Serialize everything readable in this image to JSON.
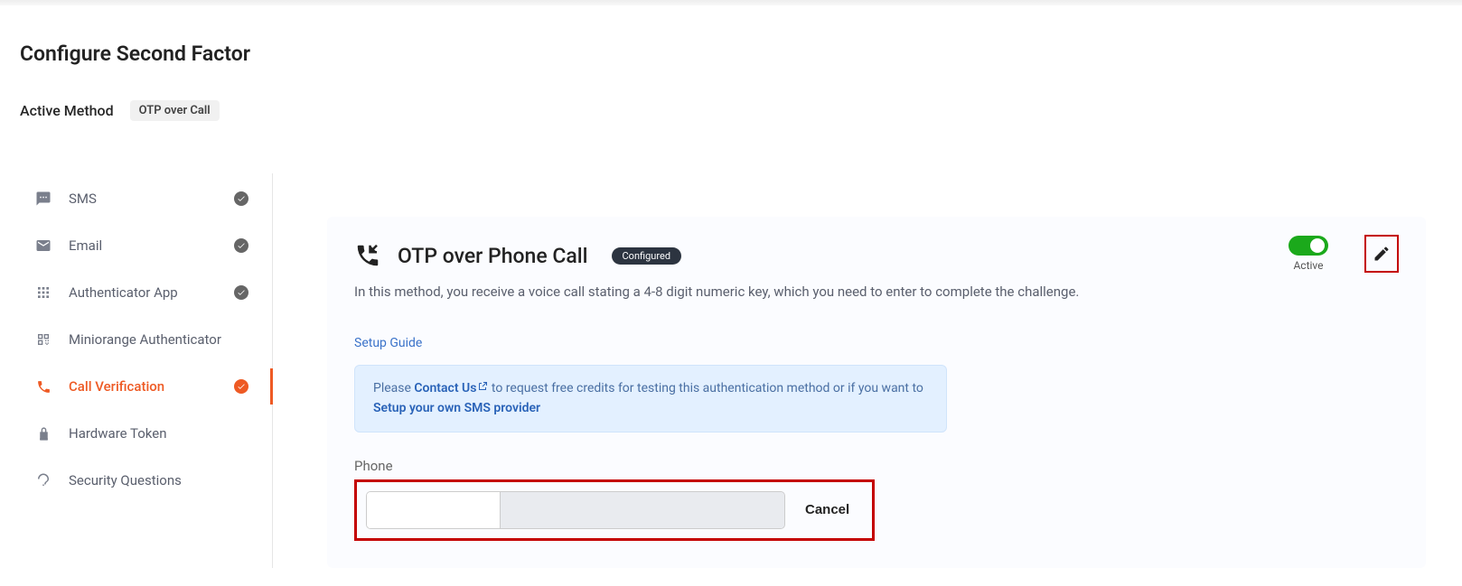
{
  "page_title": "Configure Second Factor",
  "active_method_label": "Active Method",
  "active_method_value": "OTP over Call",
  "sidebar": {
    "sms": "SMS",
    "email": "Email",
    "auth_app": "Authenticator App",
    "mini_auth": "Miniorange Authenticator",
    "call_verif": "Call Verification",
    "hw_token": "Hardware Token",
    "sec_q": "Security Questions"
  },
  "panel": {
    "title": "OTP over Phone Call",
    "configured": "Configured",
    "toggle_label": "Active",
    "description": "In this method, you receive a voice call stating a 4-8 digit numeric key, which you need to enter to complete the challenge.",
    "setup_guide": "Setup Guide",
    "info_please": "Please ",
    "info_contact": "Contact Us",
    "info_mid": " to request free credits for testing this authentication method or if you want to ",
    "info_setup": "Setup your own SMS provider",
    "phone_label": "Phone",
    "cancel": "Cancel"
  }
}
